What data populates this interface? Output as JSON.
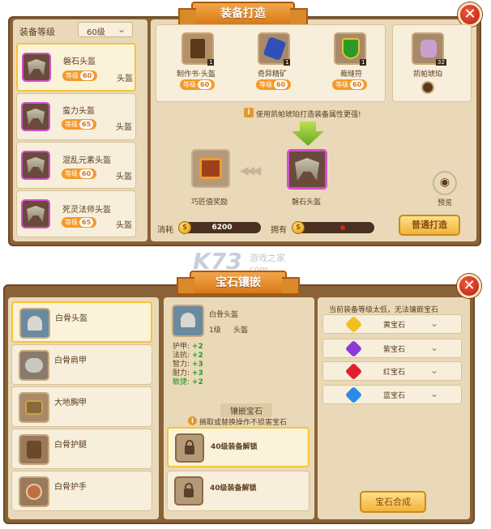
{
  "forge": {
    "title": "装备打造",
    "level_label": "装备等级",
    "level_select": "60级",
    "items": [
      {
        "name": "磐石头盔",
        "tag": "等级",
        "level": "60",
        "type": "头盔"
      },
      {
        "name": "蛮力头盔",
        "tag": "等级",
        "level": "65",
        "type": "头盔"
      },
      {
        "name": "混乱元素头盔",
        "tag": "等级",
        "level": "60",
        "type": "头盔"
      },
      {
        "name": "死灵法师头盔",
        "tag": "等级",
        "level": "65",
        "type": "头盔"
      }
    ],
    "materials": [
      {
        "name": "制作书·头盔",
        "count": "1",
        "tag": "等级",
        "level": "60"
      },
      {
        "name": "奇异精矿",
        "count": "1",
        "tag": "等级",
        "level": "60"
      },
      {
        "name": "裁缝符",
        "count": "1",
        "tag": "等级",
        "level": "60"
      }
    ],
    "amber": {
      "name": "凯帕琥珀",
      "count": "32"
    },
    "hint": "使用凯帕琥珀打造装备属性更强!",
    "reward_label": "巧匠值奖励",
    "result_label": "磐石头盔",
    "preview_label": "预览",
    "cost_label": "消耗",
    "cost_value": "6200",
    "own_label": "拥有",
    "own_value": "",
    "forge_button": "普通打造"
  },
  "watermark": {
    "logo": "K73",
    "sub": "游戏之家",
    "domain": ".com"
  },
  "gem": {
    "title": "宝石镶嵌",
    "equips": [
      {
        "name": "白骨头盔"
      },
      {
        "name": "白骨肩甲"
      },
      {
        "name": "大地胸甲"
      },
      {
        "name": "白骨护腿"
      },
      {
        "name": "白骨护手"
      }
    ],
    "detail": {
      "name": "白骨头盔",
      "level": "1级",
      "type": "头盔"
    },
    "stats": [
      {
        "label": "护甲:",
        "value": "+2"
      },
      {
        "label": "法抗:",
        "value": "+2"
      },
      {
        "label": "智力:",
        "value": "+3"
      },
      {
        "label": "耐力:",
        "value": "+3"
      },
      {
        "label": "敏捷:",
        "value": "+2"
      }
    ],
    "socket_title": "镶嵌宝石",
    "socket_hint": "摘取或替换操作不损害宝石",
    "sockets": [
      {
        "label": "40级装备解锁"
      },
      {
        "label": "40级装备解锁"
      }
    ],
    "warning": "当前装备等级太低，无法镶嵌宝石",
    "gem_types": [
      {
        "name": "黄宝石",
        "color": "#f0c020"
      },
      {
        "name": "紫宝石",
        "color": "#8a3ad8"
      },
      {
        "name": "红宝石",
        "color": "#e02030"
      },
      {
        "name": "蓝宝石",
        "color": "#2a8ae8"
      }
    ],
    "combine_button": "宝石合成"
  }
}
